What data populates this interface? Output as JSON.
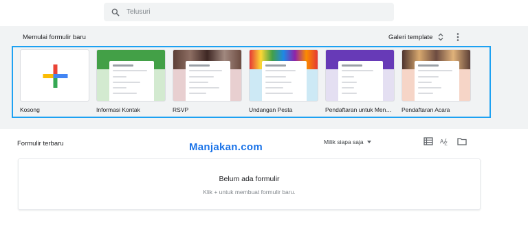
{
  "search": {
    "placeholder": "Telusuri"
  },
  "gallery": {
    "title": "Memulai formulir baru",
    "gallery_button": "Galeri template",
    "templates": [
      {
        "label": "Kosong"
      },
      {
        "label": "Informasi Kontak"
      },
      {
        "label": "RSVP"
      },
      {
        "label": "Undangan Pesta"
      },
      {
        "label": "Pendaftaran untuk Men…"
      },
      {
        "label": "Pendaftaran Acara"
      }
    ]
  },
  "recent": {
    "title": "Formulir terbaru",
    "owner_filter": "Milik siapa saja",
    "empty_title": "Belum ada formulir",
    "empty_subtitle": "Klik + untuk membuat formulir baru."
  },
  "watermark": "Manjakan.com",
  "colors": {
    "highlight": "#1da1f2",
    "band": "#f1f3f4",
    "plus_red": "#ea4335",
    "plus_blue": "#4285f4",
    "plus_green": "#34a853",
    "plus_yellow": "#fbbc04"
  }
}
